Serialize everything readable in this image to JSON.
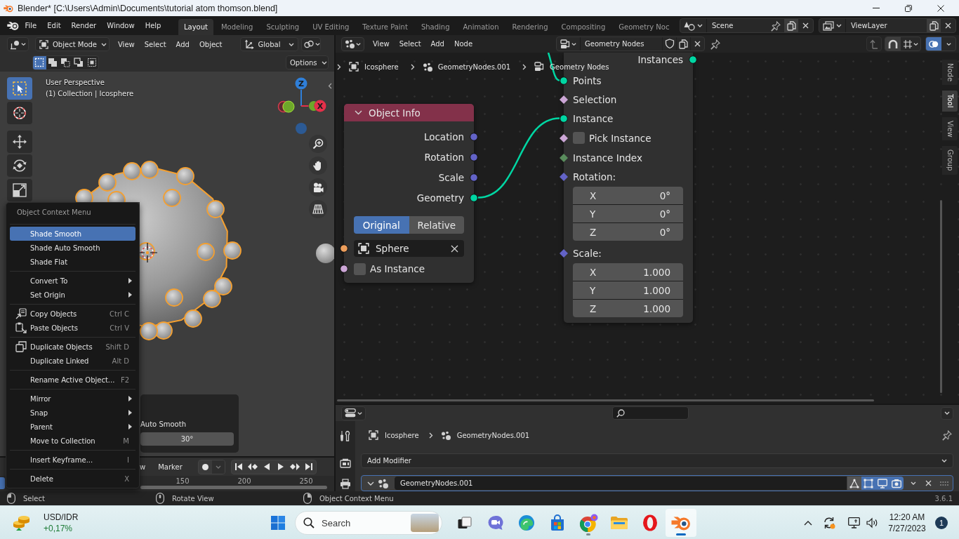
{
  "window": {
    "title": "Blender* [C:\\Users\\Admin\\Documents\\tutorial atom thomson.blend]"
  },
  "topbar": {
    "menus": [
      "File",
      "Edit",
      "Render",
      "Window",
      "Help"
    ],
    "workspaces": [
      {
        "label": "Layout",
        "selected": true
      },
      {
        "label": "Modeling",
        "selected": false
      },
      {
        "label": "Sculpting",
        "selected": false
      },
      {
        "label": "UV Editing",
        "selected": false
      },
      {
        "label": "Texture Paint",
        "selected": false
      },
      {
        "label": "Shading",
        "selected": false
      },
      {
        "label": "Animation",
        "selected": false
      },
      {
        "label": "Rendering",
        "selected": false
      },
      {
        "label": "Compositing",
        "selected": false
      },
      {
        "label": "Geometry Noc",
        "selected": false
      }
    ],
    "scene": "Scene",
    "view_layer": "ViewLayer"
  },
  "viewport": {
    "mode": "Object Mode",
    "menus": [
      "View",
      "Select",
      "Add",
      "Object"
    ],
    "orientation": "Global",
    "select_modes": [
      {
        "selected": true
      },
      {
        "selected": false
      },
      {
        "selected": false
      },
      {
        "selected": false
      },
      {
        "selected": false
      }
    ],
    "options": "Options",
    "tools": [
      {
        "selected": true
      },
      {
        "selected": false
      },
      {
        "selected": false
      },
      {
        "selected": false
      },
      {
        "selected": false
      }
    ],
    "info": [
      "User Perspective",
      "(1) Collection | Icosphere"
    ],
    "gizmo": {
      "z": "Z",
      "x": "X"
    },
    "redo_panel": {
      "label": "Auto Smooth",
      "angle": "30°"
    }
  },
  "context_menu": {
    "title": "Object Context Menu",
    "groups": [
      [
        {
          "label": "Shade Smooth",
          "kind": "plain",
          "selected": true
        },
        {
          "label": "Shade Auto Smooth",
          "kind": "plain",
          "selected": false
        },
        {
          "label": "Shade Flat",
          "kind": "plain",
          "selected": false
        }
      ],
      [
        {
          "label": "Convert To",
          "kind": "submenu",
          "selected": false
        },
        {
          "label": "Set Origin",
          "kind": "submenu",
          "selected": false
        }
      ],
      [
        {
          "label": "Copy Objects",
          "kind": "icon",
          "shortcut": "Ctrl C",
          "selected": false
        },
        {
          "label": "Paste Objects",
          "kind": "icon",
          "shortcut": "Ctrl V",
          "selected": false
        }
      ],
      [
        {
          "label": "Duplicate Objects",
          "kind": "icon",
          "shortcut": "Shift D",
          "selected": false
        },
        {
          "label": "Duplicate Linked",
          "kind": "plain",
          "shortcut": "Alt D",
          "selected": false
        }
      ],
      [
        {
          "label": "Rename Active Object...",
          "kind": "plain",
          "shortcut": "F2",
          "selected": false
        }
      ],
      [
        {
          "label": "Mirror",
          "kind": "submenu",
          "selected": false
        },
        {
          "label": "Snap",
          "kind": "submenu",
          "selected": false
        },
        {
          "label": "Parent",
          "kind": "submenu",
          "selected": false
        },
        {
          "label": "Move to Collection",
          "kind": "plain",
          "shortcut": "M",
          "selected": false
        }
      ],
      [
        {
          "label": "Insert Keyframe...",
          "kind": "plain",
          "shortcut": "I",
          "selected": false
        }
      ],
      [
        {
          "label": "Delete",
          "kind": "plain",
          "shortcut": "X",
          "selected": false
        }
      ]
    ]
  },
  "timeline": {
    "menus": [
      "w",
      "Marker"
    ],
    "frames": [
      "150",
      "200",
      "250"
    ]
  },
  "node_editor": {
    "menus": [
      "View",
      "Select",
      "Add",
      "Node"
    ],
    "node_tree": "Geometry Nodes",
    "breadcrumbs": [
      "Icosphere",
      "GeometryNodes.001",
      "Geometry Nodes"
    ],
    "side_tabs": [
      {
        "label": "Node",
        "selected": false
      },
      {
        "label": "Tool",
        "selected": true
      },
      {
        "label": "View",
        "selected": false
      },
      {
        "label": "Group",
        "selected": false
      }
    ],
    "nodes": [
      {
        "kind": "object_info",
        "title": "Object Info",
        "expanded": true,
        "outputs": [
          {
            "label": "Location",
            "color": "#6363c7",
            "linked": false
          },
          {
            "label": "Rotation",
            "color": "#6363c7",
            "linked": false
          },
          {
            "label": "Scale",
            "color": "#6363c7",
            "linked": false
          },
          {
            "label": "Geometry",
            "color": "#00d6a3",
            "linked": true
          }
        ],
        "transform_space": [
          {
            "label": "Original",
            "selected": true
          },
          {
            "label": "Relative",
            "selected": false
          }
        ],
        "object": {
          "value": "Sphere",
          "color": "#ed9e5c"
        },
        "as_instance": {
          "label": "As Instance",
          "checked": false,
          "color": "#cca6d6"
        }
      },
      {
        "kind": "instance_on_points",
        "outputs": [
          {
            "label": "Instances",
            "color": "#00d6a3"
          }
        ],
        "inputs": [
          {
            "label": "Points",
            "kind": "circle",
            "color": "#00d6a3",
            "linked": true
          },
          {
            "label": "Selection",
            "kind": "diamond",
            "color": "#cca6d6",
            "linked": false
          },
          {
            "label": "Instance",
            "kind": "circle",
            "color": "#00d6a3",
            "linked": true
          },
          {
            "label": "Pick Instance",
            "kind": "diamond",
            "color": "#cca6d6",
            "linked": false,
            "checked": false
          },
          {
            "label": "Instance Index",
            "kind": "diamond",
            "color": "#598c5c",
            "linked": false
          },
          {
            "label": "Rotation:",
            "kind": "diamond",
            "color": "#6363c7",
            "linked": false,
            "fields": [
              {
                "axis": "X",
                "value": "0°"
              },
              {
                "axis": "Y",
                "value": "0°"
              },
              {
                "axis": "Z",
                "value": "0°"
              }
            ]
          },
          {
            "label": "Scale:",
            "kind": "diamond",
            "color": "#6363c7",
            "linked": false,
            "fields": [
              {
                "axis": "X",
                "value": "1.000"
              },
              {
                "axis": "Y",
                "value": "1.000"
              },
              {
                "axis": "Z",
                "value": "1.000"
              }
            ]
          }
        ]
      }
    ]
  },
  "properties": {
    "breadcrumbs": [
      "Icosphere",
      "GeometryNodes.001"
    ],
    "add_modifier": "Add Modifier",
    "modifier": {
      "name": "GeometryNodes.001",
      "expanded": true,
      "toggles": [
        {
          "on": false
        },
        {
          "on": true
        },
        {
          "on": true
        },
        {
          "on": true
        }
      ]
    }
  },
  "status_bar": {
    "hints": [
      "Select",
      "Rotate View",
      "Object Context Menu"
    ],
    "version": "3.6.1"
  },
  "taskbar": {
    "widget": {
      "label": "USD/IDR",
      "change": "+0,17%"
    },
    "search": {
      "placeholder": "Search"
    },
    "apps": [
      {
        "selected": false,
        "running": false
      },
      {
        "selected": false,
        "running": false
      },
      {
        "selected": false,
        "running": false
      },
      {
        "selected": false,
        "running": false
      },
      {
        "selected": false,
        "running": true
      },
      {
        "selected": false,
        "running": false
      },
      {
        "selected": false,
        "running": false
      },
      {
        "selected": true,
        "running": true
      }
    ],
    "clock": {
      "time": "12:20 AM",
      "date": "7/27/2023"
    },
    "notifications": "1"
  }
}
